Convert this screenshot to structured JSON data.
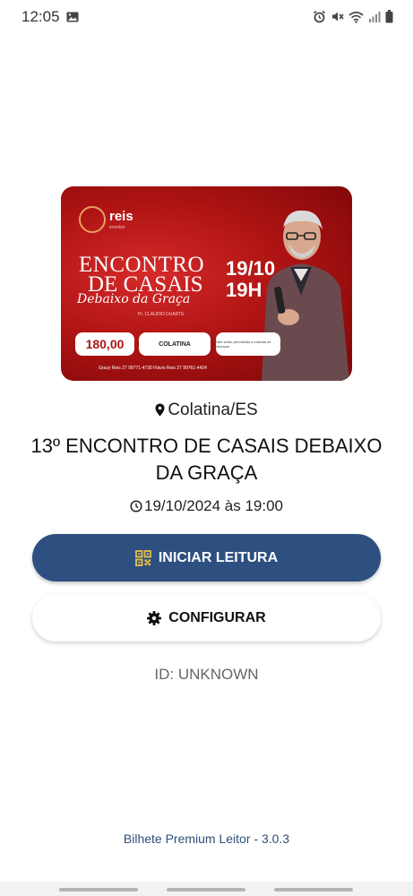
{
  "status_bar": {
    "time": "12:05",
    "left_icons": [
      "gallery-icon"
    ],
    "right_icons": [
      "alarm-icon",
      "mute-icon",
      "wifi-icon",
      "signal-icon",
      "battery-icon"
    ]
  },
  "banner": {
    "logo_text": "reis",
    "logo_sub": "eventos",
    "title_line1": "ENCONTRO",
    "title_line2": "DE CASAIS",
    "title_line3": "Debaixo da Graça",
    "pastor": "Pr. CLÁUDIO DUARTE",
    "date": "19/10",
    "hour": "19H",
    "price": "180,00",
    "city": "COLATINA",
    "note": "Não serão permitidas a entrada de crianças.",
    "contacts": "Grazy Reis 27 99771-4730   Flávio Reis 27 99761-4424"
  },
  "event": {
    "location": "Colatina/ES",
    "title": "13º ENCONTRO DE CASAIS DEBAIXO DA GRAÇA",
    "datetime": "19/10/2024 às 19:00"
  },
  "actions": {
    "start_reading_label": "INICIAR LEITURA",
    "configure_label": "CONFIGURAR"
  },
  "device": {
    "id_text": "ID: UNKNOWN"
  },
  "footer": {
    "version_text": "Bilhete Premium Leitor - 3.0.3"
  },
  "colors": {
    "primary_button": "#2e5080",
    "qr_icon": "#e8c04a",
    "footer_text": "#2e4f7a",
    "banner_red": "#b01414"
  }
}
